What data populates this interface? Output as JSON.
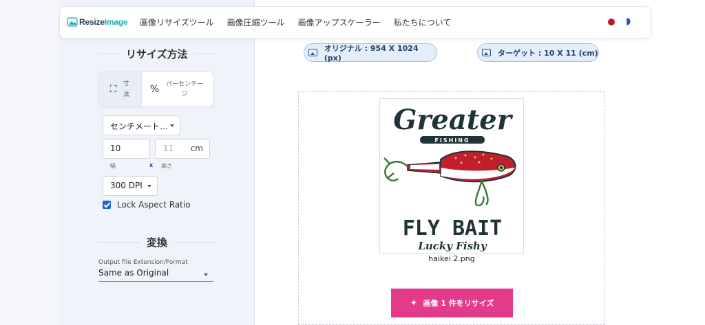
{
  "header": {
    "logo": {
      "text_a": "Resize",
      "text_b": "Image"
    },
    "nav": [
      "画像リサイズツール",
      "画像圧縮ツール",
      "画像アップスケーラー",
      "私たちについて"
    ]
  },
  "sidebar": {
    "resize_method_title": "リサイズ方法",
    "mode_dimensions_label": "寸法",
    "mode_percentage_label": "パーセンテージ",
    "unit_select": "センチメート…",
    "width_value": "10",
    "height_placeholder": "11",
    "height_unit": "cm",
    "width_label": "幅",
    "x_label": "x",
    "height_label": "高さ",
    "dpi_select": "300 DPI",
    "lock_aspect_label": "Lock Aspect Ratio",
    "lock_aspect_checked": true,
    "convert_title": "変換",
    "format_label": "Output file Extension/Format",
    "format_value": "Same as Original"
  },
  "main": {
    "original_pill": "オリジナル : 954 X 1024 (px)",
    "target_pill": "ターゲット : 10 X 11 (cm)",
    "image": {
      "title_text": "Greater",
      "banner_text": "FISHING",
      "main_text": "FLY BAIT",
      "script_text": "Lucky Fishy"
    },
    "filename": "haikei 2.png",
    "resize_button": "画像 1 件をリサイズ"
  },
  "colors": {
    "accent": "#e33a8a",
    "check": "#1e63d7",
    "pill_bg": "#e4eefb"
  }
}
